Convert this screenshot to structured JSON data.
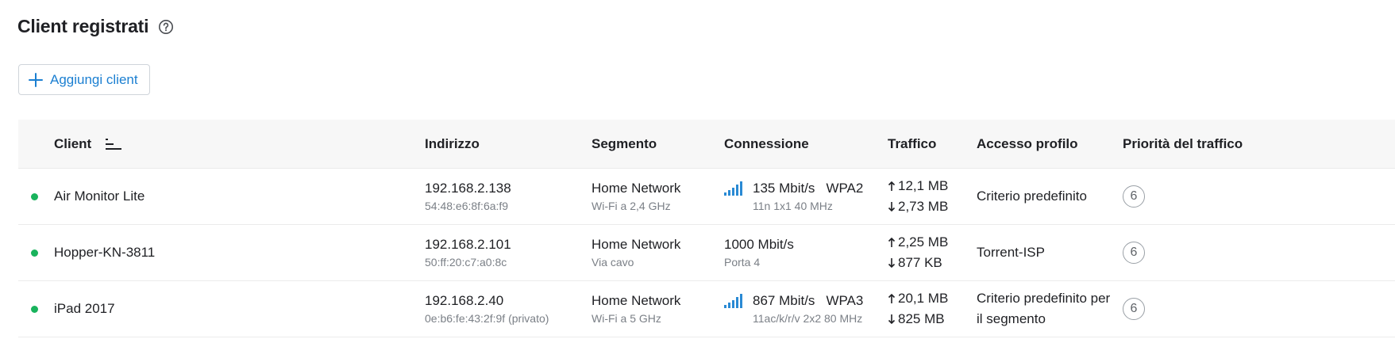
{
  "page": {
    "title": "Client registrati",
    "add_button": "Aggiungi client"
  },
  "table": {
    "columns": {
      "client": "Client",
      "address": "Indirizzo",
      "segment": "Segmento",
      "connection": "Connessione",
      "traffic": "Traffico",
      "profile": "Accesso profilo",
      "priority": "Priorità del traffico"
    },
    "rows": [
      {
        "status": "online",
        "name": "Air Monitor Lite",
        "ip": "192.168.2.138",
        "mac": "54:48:e6:8f:6a:f9",
        "segment": "Home Network",
        "segment_type": "Wi-Fi a 2,4 GHz",
        "speed": "135 Mbit/s",
        "security": "WPA2",
        "conn_detail": "11n 1x1 40 MHz",
        "upload": "12,1 MB",
        "download": "2,73 MB",
        "profile": "Criterio predefinito",
        "priority": "6",
        "signal_icon": "wifi-signal-icon"
      },
      {
        "status": "online",
        "name": "Hopper-KN-3811",
        "ip": "192.168.2.101",
        "mac": "50:ff:20:c7:a0:8c",
        "segment": "Home Network",
        "segment_type": "Via cavo",
        "speed": "1000 Mbit/s",
        "security": "",
        "conn_detail": "Porta 4",
        "upload": "2,25 MB",
        "download": "877 KB",
        "profile": "Torrent-ISP",
        "priority": "6",
        "signal_icon": ""
      },
      {
        "status": "online",
        "name": "iPad 2017",
        "ip": "192.168.2.40",
        "mac": "0e:b6:fe:43:2f:9f (privato)",
        "segment": "Home Network",
        "segment_type": "Wi-Fi a 5 GHz",
        "speed": "867 Mbit/s",
        "security": "WPA3",
        "conn_detail": "11ac/k/r/v 2x2 80 MHz",
        "upload": "20,1 MB",
        "download": "825 MB",
        "profile": "Criterio predefinito per il segmento",
        "priority": "6",
        "signal_icon": "wifi-signal-icon"
      }
    ]
  },
  "colors": {
    "accent": "#1b7fd1",
    "online": "#19b35c",
    "signal": "#2a8ad4"
  },
  "icons": {
    "help": "help-circle-icon",
    "add": "plus-icon",
    "sort": "sort-icon",
    "upload": "arrow-up-icon",
    "download": "arrow-down-icon"
  }
}
